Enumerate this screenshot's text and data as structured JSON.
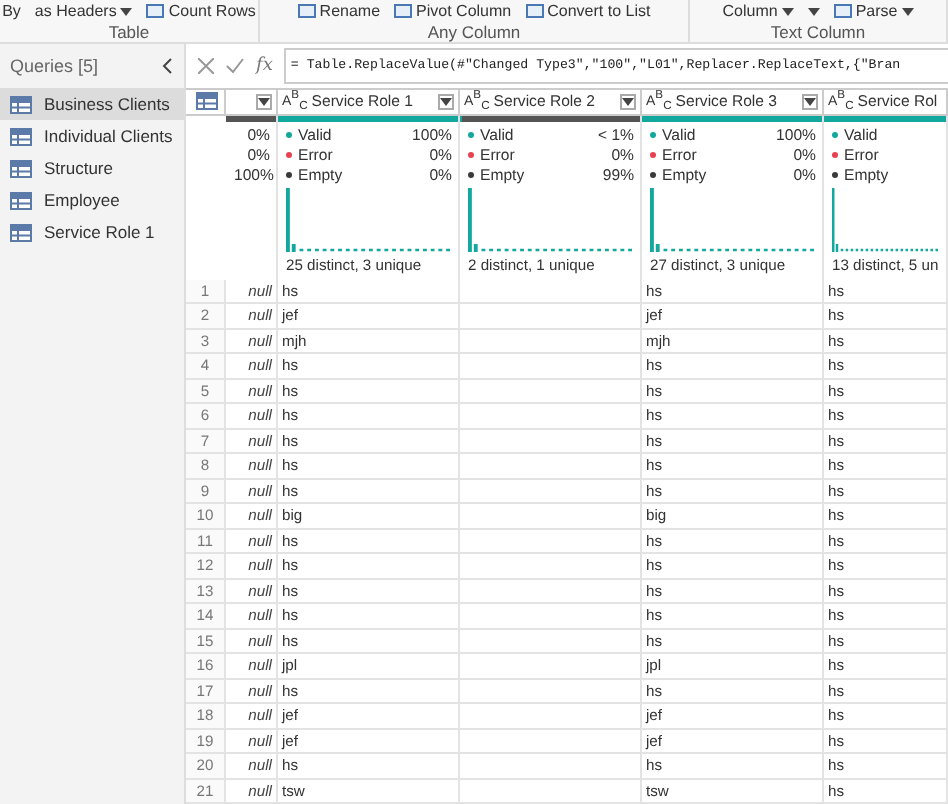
{
  "ribbon": {
    "groups": [
      {
        "label": "Table",
        "items": [
          {
            "label": "By",
            "icon": false,
            "caret": false
          },
          {
            "label": "as Headers",
            "icon": false,
            "caret": true
          },
          {
            "label": "Count Rows",
            "icon": true,
            "caret": false
          }
        ]
      },
      {
        "label": "Any Column",
        "items": [
          {
            "label": "Rename",
            "icon": true,
            "caret": false
          },
          {
            "label": "Pivot Column",
            "icon": true,
            "caret": false
          },
          {
            "label": "Convert to List",
            "icon": true,
            "caret": false
          }
        ]
      },
      {
        "label": "Text Column",
        "items": [
          {
            "label": "Column",
            "icon": false,
            "caret": true
          },
          {
            "icon": false,
            "caret": true
          },
          {
            "label": "Parse",
            "icon": true,
            "caret": true
          }
        ]
      }
    ]
  },
  "queries": {
    "title": "Queries [5]",
    "items": [
      {
        "label": "Business Clients",
        "selected": true
      },
      {
        "label": "Individual Clients",
        "selected": false
      },
      {
        "label": "Structure",
        "selected": false
      },
      {
        "label": "Employee",
        "selected": false
      },
      {
        "label": "Service Role 1",
        "selected": false
      }
    ]
  },
  "formula_bar": {
    "fx_label": "fx",
    "formula": "= Table.ReplaceValue(#\"Changed Type3\",\"100\",\"L01\",Replacer.ReplaceText,{\"Bran"
  },
  "columns": [
    {
      "kind": "unnamed",
      "level": 0,
      "stats": [
        {
          "value": "0%"
        },
        {
          "value": "0%"
        },
        {
          "value": "100%"
        }
      ]
    },
    {
      "kind": "text",
      "type_label": "A$^{B}$$_{C}$",
      "name": "Service Role 1",
      "level": 1,
      "stats": [
        {
          "label": "Valid",
          "value": "100%"
        },
        {
          "label": "Error",
          "value": "0%"
        },
        {
          "label": "Empty",
          "value": "0%"
        }
      ],
      "distinct": "25 distinct, 3 unique"
    },
    {
      "kind": "text",
      "type_label": "A$^{B}$$_{C}$",
      "name": "Service Role 2",
      "level": 0.01,
      "stats": [
        {
          "label": "Valid",
          "value": "< 1%"
        },
        {
          "label": "Error",
          "value": "0%"
        },
        {
          "label": "Empty",
          "value": "99%"
        }
      ],
      "distinct": "2 distinct, 1 unique"
    },
    {
      "kind": "text",
      "type_label": "A$^{B}$$_{C}$",
      "name": "Service Role 3",
      "level": 1,
      "stats": [
        {
          "label": "Valid",
          "value": "100%"
        },
        {
          "label": "Error",
          "value": "0%"
        },
        {
          "label": "Empty",
          "value": "0%"
        }
      ],
      "distinct": "27 distinct, 3 unique"
    },
    {
      "kind": "text",
      "type_label": "A$^{B}$$_{C}$",
      "name": "Service Rol",
      "level": 1,
      "stats": [
        {
          "label": "Valid"
        },
        {
          "label": "Error"
        },
        {
          "label": "Empty"
        }
      ],
      "distinct": "13 distinct, 5 un"
    }
  ],
  "rows": [
    {
      "number": "1",
      "cells": [
        "null",
        "hs",
        null,
        "hs",
        "hs"
      ]
    },
    {
      "number": "2",
      "cells": [
        "null",
        "jef",
        null,
        "jef",
        "hs"
      ]
    },
    {
      "number": "3",
      "cells": [
        "null",
        "mjh",
        null,
        "mjh",
        "hs"
      ]
    },
    {
      "number": "4",
      "cells": [
        "null",
        "hs",
        null,
        "hs",
        "hs"
      ]
    },
    {
      "number": "5",
      "cells": [
        "null",
        "hs",
        null,
        "hs",
        "hs"
      ]
    },
    {
      "number": "6",
      "cells": [
        "null",
        "hs",
        null,
        "hs",
        "hs"
      ]
    },
    {
      "number": "7",
      "cells": [
        "null",
        "hs",
        null,
        "hs",
        "hs"
      ]
    },
    {
      "number": "8",
      "cells": [
        "null",
        "hs",
        null,
        "hs",
        "hs"
      ]
    },
    {
      "number": "9",
      "cells": [
        "null",
        "hs",
        null,
        "hs",
        "hs"
      ]
    },
    {
      "number": "10",
      "cells": [
        "null",
        "big",
        null,
        "big",
        "hs"
      ]
    },
    {
      "number": "11",
      "cells": [
        "null",
        "hs",
        null,
        "hs",
        "hs"
      ]
    },
    {
      "number": "12",
      "cells": [
        "null",
        "hs",
        null,
        "hs",
        "hs"
      ]
    },
    {
      "number": "13",
      "cells": [
        "null",
        "hs",
        null,
        "hs",
        "hs"
      ]
    },
    {
      "number": "14",
      "cells": [
        "null",
        "hs",
        null,
        "hs",
        "hs"
      ]
    },
    {
      "number": "15",
      "cells": [
        "null",
        "hs",
        null,
        "hs",
        "hs"
      ]
    },
    {
      "number": "16",
      "cells": [
        "null",
        "jpl",
        null,
        "jpl",
        "hs"
      ]
    },
    {
      "number": "17",
      "cells": [
        "null",
        "hs",
        null,
        "hs",
        "hs"
      ]
    },
    {
      "number": "18",
      "cells": [
        "null",
        "jef",
        null,
        "jef",
        "hs"
      ]
    },
    {
      "number": "19",
      "cells": [
        "null",
        "jef",
        null,
        "jef",
        "hs"
      ]
    },
    {
      "number": "20",
      "cells": [
        "null",
        "hs",
        null,
        "hs",
        "hs"
      ]
    },
    {
      "number": "21",
      "cells": [
        "null",
        "tsw",
        null,
        "tsw",
        "hs"
      ]
    }
  ]
}
